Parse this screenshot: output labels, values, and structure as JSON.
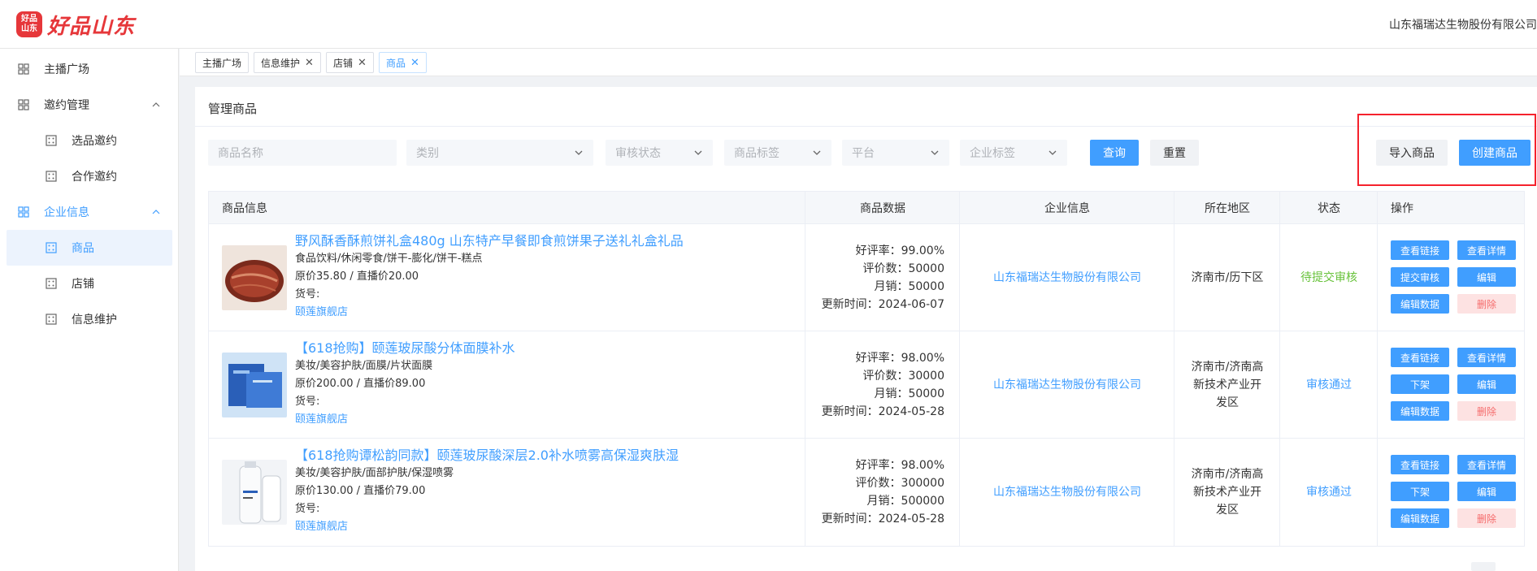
{
  "header": {
    "logo_badge": "好品山东",
    "logo_text": "好品山东",
    "company": "山东福瑞达生物股份有限公司",
    "brand_color": "#e6373a"
  },
  "sidebar": {
    "items": [
      {
        "label": "主播广场",
        "icon": "grid-icon"
      },
      {
        "label": "邀约管理",
        "icon": "grid-icon",
        "expanded": true
      },
      {
        "label": "选品邀约",
        "icon": "dice-icon"
      },
      {
        "label": "合作邀约",
        "icon": "dice-icon"
      },
      {
        "label": "企业信息",
        "icon": "grid-icon",
        "expanded": true
      },
      {
        "label": "商品",
        "icon": "dice-icon",
        "active": true
      },
      {
        "label": "店铺",
        "icon": "dice-icon"
      },
      {
        "label": "信息维护",
        "icon": "dice-icon"
      }
    ]
  },
  "tabs": [
    {
      "label": "主播广场",
      "closable": false
    },
    {
      "label": "信息维护",
      "closable": true
    },
    {
      "label": "店铺",
      "closable": true
    },
    {
      "label": "商品",
      "closable": true,
      "current": true
    }
  ],
  "card": {
    "title": "管理商品"
  },
  "filters": {
    "product_name_placeholder": "商品名称",
    "category_placeholder": "类别",
    "review_status_placeholder": "审核状态",
    "product_tag_placeholder": "商品标签",
    "platform_placeholder": "平台",
    "enterprise_tag_placeholder": "企业标签",
    "query_label": "查询",
    "reset_label": "重置",
    "import_label": "导入商品",
    "create_label": "创建商品"
  },
  "table": {
    "headers": {
      "info": "商品信息",
      "data": "商品数据",
      "enterprise": "企业信息",
      "region": "所在地区",
      "status": "状态",
      "ops": "操作"
    },
    "rows": [
      {
        "title": "野风酥香酥煎饼礼盒480g 山东特产早餐即食煎饼果子送礼礼盒礼品",
        "category": "食品饮料/休闲零食/饼干-膨化/饼干-糕点",
        "price": "原价35.80 / 直播价20.00",
        "sku": "货号:",
        "shop": "颐莲旗舰店",
        "rating": "好评率：99.00%",
        "reviews": "评价数：50000",
        "monthly": "月销：50000",
        "updated": "更新时间：2024-06-07",
        "company": "山东福瑞达生物股份有限公司",
        "region_lines": [
          "济南市/历下区"
        ],
        "status": "待提交审核",
        "ops": [
          "查看链接",
          "查看详情",
          "提交审核",
          "编辑",
          "编辑数据",
          "删除"
        ]
      },
      {
        "title": "【618抢购】颐莲玻尿酸分体面膜补水",
        "category": "美妆/美容护肤/面膜/片状面膜",
        "price": "原价200.00 / 直播价89.00",
        "sku": "货号:",
        "shop": "颐莲旗舰店",
        "rating": "好评率：98.00%",
        "reviews": "评价数：30000",
        "monthly": "月销：50000",
        "updated": "更新时间：2024-05-28",
        "company": "山东福瑞达生物股份有限公司",
        "region_lines": [
          "济南市/济南高",
          "新技术产业开",
          "发区"
        ],
        "status": "审核通过",
        "ops": [
          "查看链接",
          "查看详情",
          "下架",
          "编辑",
          "编辑数据",
          "删除"
        ]
      },
      {
        "title": "【618抢购谭松韵同款】颐莲玻尿酸深层2.0补水喷雾高保湿爽肤湿",
        "category": "美妆/美容护肤/面部护肤/保湿喷雾",
        "price": "原价130.00 / 直播价79.00",
        "sku": "货号:",
        "shop": "颐莲旗舰店",
        "rating": "好评率：98.00%",
        "reviews": "评价数：300000",
        "monthly": "月销：500000",
        "updated": "更新时间：2024-05-28",
        "company": "山东福瑞达生物股份有限公司",
        "region_lines": [
          "济南市/济南高",
          "新技术产业开",
          "发区"
        ],
        "status": "审核通过",
        "ops": [
          "查看链接",
          "查看详情",
          "下架",
          "编辑",
          "编辑数据",
          "删除"
        ]
      }
    ]
  },
  "colors": {
    "primary": "#409eff",
    "success": "#67c23a",
    "danger": "#f56c6c",
    "highlight_border": "#f5222d"
  }
}
